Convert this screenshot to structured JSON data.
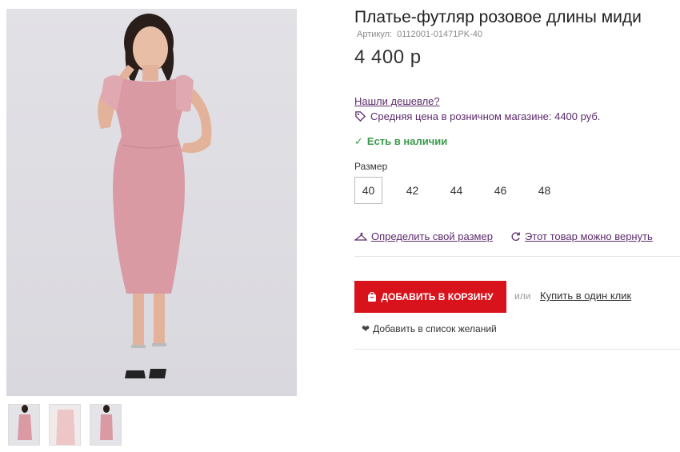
{
  "product": {
    "title": "Платье-футляр розовое длины миди",
    "article_label": "Артикул:",
    "article_value": "0112001-01471PK-40",
    "price": "4 400 р"
  },
  "pricing": {
    "cheaper_link": "Нашли дешевле?",
    "avg_price_text": "Средняя цена в розничном магазине: 4400 руб.",
    "avg_price_icon": "price-tag-icon"
  },
  "availability": {
    "check": "✓",
    "text": "Есть в наличии",
    "color": "#3a9a4a"
  },
  "size": {
    "label": "Размер",
    "options": [
      "40",
      "42",
      "44",
      "46",
      "48"
    ],
    "selected": "40"
  },
  "links": {
    "size_guide": "Определить свой размер",
    "return_policy": "Этот товар можно вернуть"
  },
  "cart": {
    "add_label": "ДОБАВИТЬ В КОРЗИНУ",
    "or": "или",
    "one_click": "Купить в один клик",
    "wishlist": "Добавить в список желаний"
  },
  "colors": {
    "accent_red": "#d9131c",
    "link_purple": "#5c2b6b",
    "dress_pink": "#d99aa3"
  },
  "gallery": {
    "thumb_count": 3
  }
}
